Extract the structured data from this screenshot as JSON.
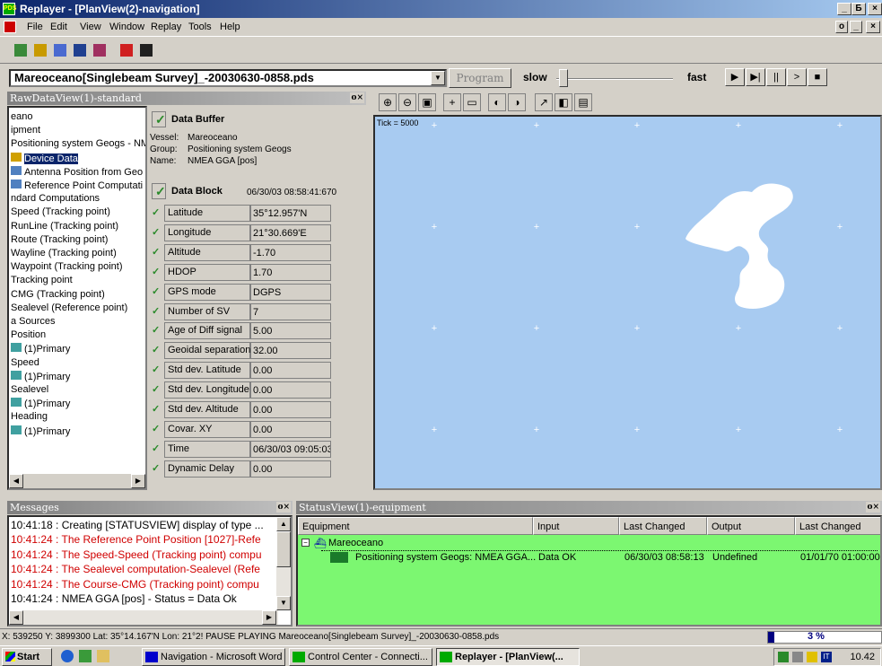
{
  "window": {
    "title": "Replayer - [PlanView(2)-navigation]",
    "app_icon_text": "PDS",
    "minimize": "_",
    "maximize": "Б",
    "close": "×"
  },
  "menu": {
    "items": [
      "File",
      "Edit",
      "View",
      "Window",
      "Replay",
      "Tools",
      "Help"
    ]
  },
  "replay_bar": {
    "file": "Mareoceano[Singlebeam Survey]_-20030630-0858.pds",
    "program_label": "Program",
    "slow_label": "slow",
    "fast_label": "fast",
    "speed_fraction": 0.02,
    "buttons": [
      "▶",
      "▶|",
      "||",
      ">",
      "■"
    ]
  },
  "raw_panel": {
    "title": "RawDataView(1)-standard",
    "tree": [
      "eano",
      "ipment",
      "Positioning system Geogs - NME",
      "Device Data",
      "Antenna Position from Geo",
      "Reference Point Computati",
      "ndard Computations",
      "Speed (Tracking point)",
      "RunLine (Tracking point)",
      "Route (Tracking point)",
      "Wayline (Tracking point)",
      "Waypoint (Tracking point)",
      "Tracking point",
      "CMG (Tracking point)",
      "Sealevel (Reference point)",
      "a Sources",
      "Position",
      "(1)Primary",
      "Speed",
      "(1)Primary",
      "Sealevel",
      "(1)Primary",
      "Heading",
      "(1)Primary"
    ],
    "buffer": {
      "heading": "Data Buffer",
      "vessel_label": "Vessel:",
      "vessel": "Mareoceano",
      "group_label": "Group:",
      "group": "Positioning system Geogs",
      "name_label": "Name:",
      "name": "NMEA GGA [pos]"
    },
    "block": {
      "heading": "Data Block",
      "timestamp": "06/30/03 08:58:41:670",
      "rows": [
        {
          "k": "Latitude",
          "v": "35°12.957'N"
        },
        {
          "k": "Longitude",
          "v": "21°30.669'E"
        },
        {
          "k": "Altitude",
          "v": "-1.70"
        },
        {
          "k": "HDOP",
          "v": "1.70"
        },
        {
          "k": "GPS mode",
          "v": "DGPS"
        },
        {
          "k": "Number of SV",
          "v": "7"
        },
        {
          "k": "Age of Diff signal",
          "v": "5.00"
        },
        {
          "k": "Geoidal separation",
          "v": "32.00"
        },
        {
          "k": "Std dev. Latitude",
          "v": "0.00"
        },
        {
          "k": "Std dev. Longitude",
          "v": "0.00"
        },
        {
          "k": "Std dev. Altitude",
          "v": "0.00"
        },
        {
          "k": "Covar. XY",
          "v": "0.00"
        },
        {
          "k": "Time",
          "v": "06/30/03 09:05:03:"
        },
        {
          "k": "Dynamic Delay",
          "v": "0.00"
        }
      ]
    }
  },
  "plan_panel": {
    "tick_label": "Tick = 5000",
    "tool_icons": [
      "zoom-in-icon",
      "zoom-out-icon",
      "zoom-extents-icon",
      "crosshair-icon",
      "ruler-icon",
      "pan-icon",
      "center-icon",
      "line-icon",
      "layers-icon",
      "properties-icon"
    ],
    "colors": {
      "sea": "#a8cbf1",
      "land": "#ffffff"
    }
  },
  "messages": {
    "title": "Messages",
    "lines": [
      {
        "text": "10:41:18 : Creating [STATUSVIEW] display of type ...",
        "color": "#000000"
      },
      {
        "text": "10:41:24 : The Reference Point Position [1027]-Refe",
        "color": "#d00000"
      },
      {
        "text": "10:41:24 : The Speed-Speed (Tracking point) compu",
        "color": "#d00000"
      },
      {
        "text": "10:41:24 : The Sealevel computation-Sealevel (Refe",
        "color": "#d00000"
      },
      {
        "text": "10:41:24 : The Course-CMG (Tracking point) compu",
        "color": "#d00000"
      },
      {
        "text": "10:41:24 : NMEA GGA [pos] - Status = Data Ok",
        "color": "#000000"
      }
    ]
  },
  "statusview": {
    "title": "StatusView(1)-equipment",
    "headers": [
      "Equipment",
      "Input",
      "Last Changed",
      "Output",
      "Last Changed"
    ],
    "vessel": "Mareoceano",
    "row": {
      "equipment": "Positioning system Geogs: NMEA GGA...",
      "input": "Data OK",
      "last_changed_in": "06/30/03 08:58:13",
      "output": "Undefined",
      "last_changed_out": "01/01/70 01:00:00"
    }
  },
  "statusbar": {
    "text": "X: 539250  Y: 3899300  Lat: 35°14.167'N  Lon: 21°2! PAUSE PLAYING  Mareoceano[Singlebeam Survey]_-20030630-0858.pds",
    "progress_label": "3 %",
    "progress_fraction": 0.03
  },
  "taskbar": {
    "start": "Start",
    "tasks": [
      {
        "label": "Navigation - Microsoft Word",
        "active": false
      },
      {
        "label": "Control Center - Connecti...",
        "active": false
      },
      {
        "label": "Replayer - [PlanView(...",
        "active": true
      }
    ],
    "clock": "10.42"
  }
}
